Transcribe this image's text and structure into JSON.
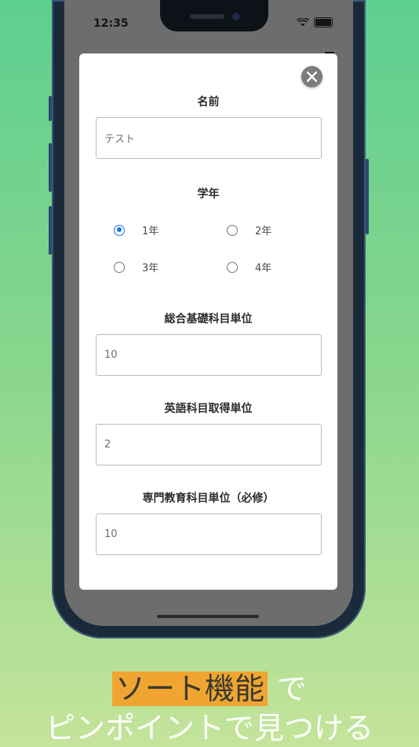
{
  "status": {
    "time": "12:35"
  },
  "modal": {
    "name_label": "名前",
    "name_value": "テスト",
    "grade_label": "学年",
    "grades": [
      {
        "label": "1年",
        "selected": true
      },
      {
        "label": "2年",
        "selected": false
      },
      {
        "label": "3年",
        "selected": false
      },
      {
        "label": "4年",
        "selected": false
      }
    ],
    "general_credits_label": "総合基礎科目単位",
    "general_credits_value": "10",
    "english_credits_label": "英語科目取得単位",
    "english_credits_value": "2",
    "specialized_credits_label": "専門教育科目単位（必修）",
    "specialized_credits_value": "10"
  },
  "caption": {
    "highlight": "ソート機能",
    "suffix": " で",
    "line2": "ピンポイントで見つける"
  },
  "colors": {
    "accent": "#1a73e8",
    "highlight": "#f0a533"
  }
}
